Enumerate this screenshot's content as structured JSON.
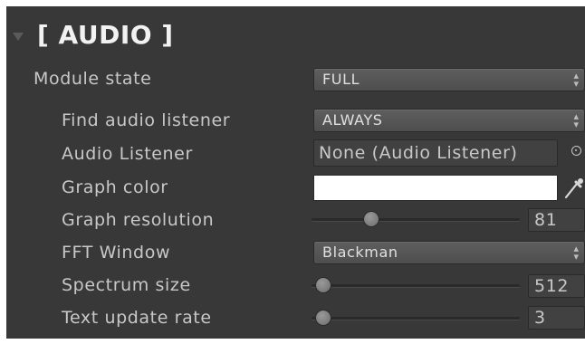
{
  "section": {
    "title": "[ AUDIO ]"
  },
  "module_state": {
    "label": "Module state",
    "value": "FULL"
  },
  "find_audio_listener": {
    "label": "Find audio listener",
    "value": "ALWAYS"
  },
  "audio_listener": {
    "label": "Audio Listener",
    "value": "None (Audio Listener)"
  },
  "graph_color": {
    "label": "Graph color",
    "value": "#ffffff"
  },
  "graph_resolution": {
    "label": "Graph resolution",
    "value": "81",
    "slider_fraction": 0.25
  },
  "fft_window": {
    "label": "FFT Window",
    "value": "Blackman"
  },
  "spectrum_size": {
    "label": "Spectrum size",
    "value": "512",
    "slider_fraction": 0.0
  },
  "text_update_rate": {
    "label": "Text update rate",
    "value": "3",
    "slider_fraction": 0.0
  },
  "colors": {
    "panel_bg": "#383838",
    "label_text": "#c8c8c8",
    "title_text": "#f2f2f2"
  }
}
